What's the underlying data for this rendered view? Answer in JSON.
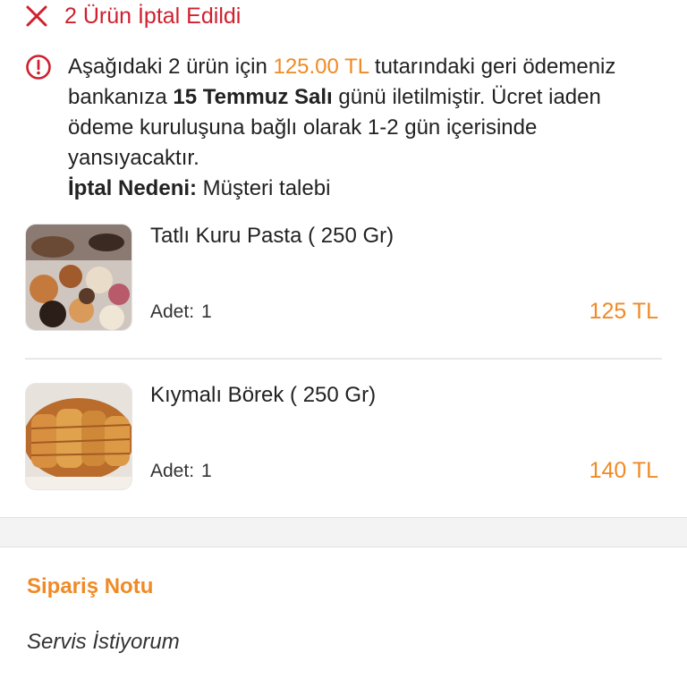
{
  "header": {
    "title": "2 Ürün İptal Edildi",
    "close_icon": "close-icon",
    "color": "#d0202e"
  },
  "notice": {
    "icon": "info-icon",
    "part1": "Aşağıdaki 2 ürün için ",
    "amount": "125.00 TL",
    "part2": " tutarındaki geri ödemeniz bankanıza ",
    "date": "15 Temmuz Salı",
    "part3": " günü iletilmiştir. Ücret iaden ödeme kuruluşuna bağlı olarak 1-2 gün içerisinde yansıyacaktır.",
    "reason_label": "İptal Nedeni:",
    "reason_value": " Müşteri talebi"
  },
  "items": [
    {
      "name": "Tatlı Kuru Pasta ( 250 Gr)",
      "qty_label": "Adet:",
      "qty": "1",
      "price": "125 TL"
    },
    {
      "name": "Kıymalı Börek ( 250 Gr)",
      "qty_label": "Adet:",
      "qty": "1",
      "price": "140 TL"
    }
  ],
  "order_note": {
    "title": "Sipariş Notu",
    "text": "Servis İstiyorum"
  },
  "colors": {
    "accent": "#f08a24",
    "cancel_red": "#d0202e"
  }
}
